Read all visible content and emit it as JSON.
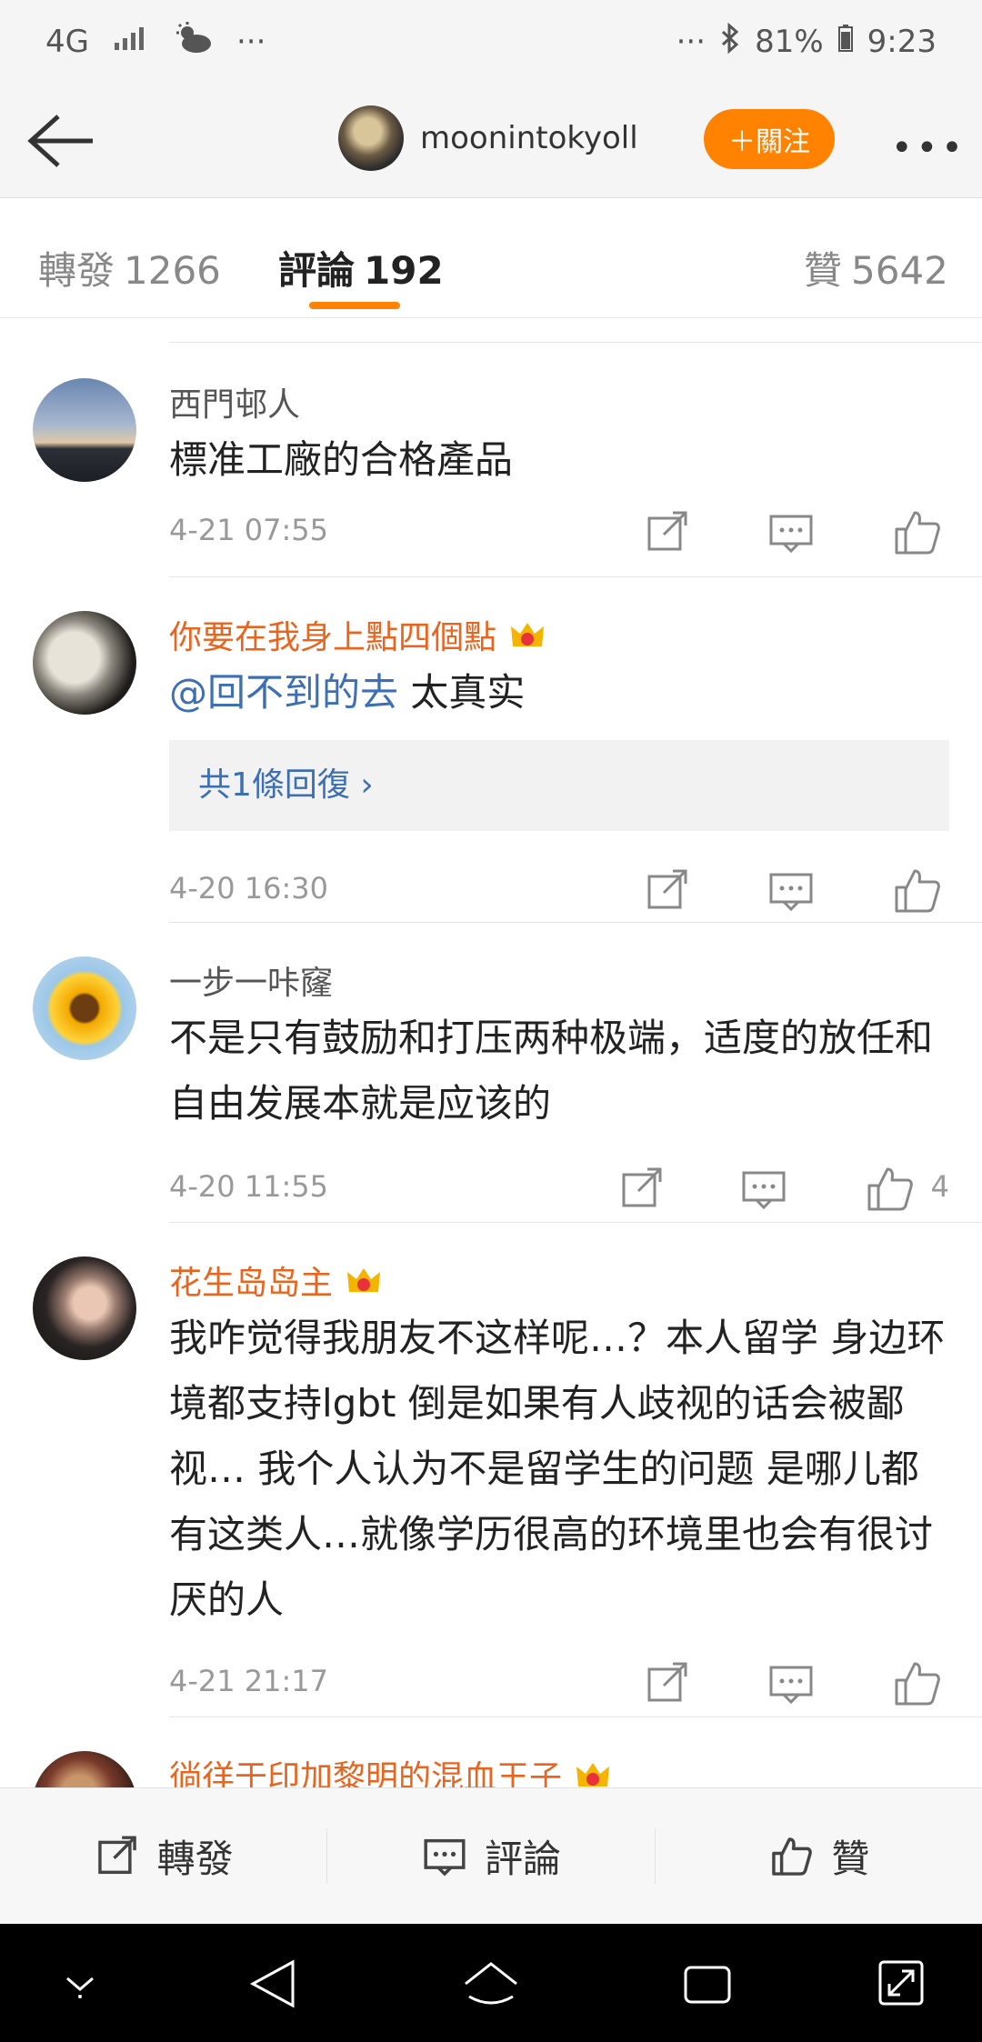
{
  "status_bar": {
    "network": "4G",
    "signal": "signal-icon",
    "weather": "cloudy-icon",
    "dots_left": "···",
    "dots_right": "···",
    "bluetooth": "bluetooth-icon",
    "battery": "81%",
    "time": "9:23"
  },
  "header": {
    "username": "moonintokyoll",
    "follow_label": "＋關注",
    "more_label": "•••"
  },
  "tabs": [
    {
      "label": "轉發",
      "count": "1266"
    },
    {
      "label": "評論",
      "count": "192"
    },
    {
      "label": "贊",
      "count": "5642"
    }
  ],
  "comments": [
    {
      "name": "西門邨人",
      "text": "標准工廠的合格產品",
      "time": "4-21 07:55",
      "likes": ""
    },
    {
      "name": "你要在我身上點四個點",
      "mention": "@回不到的去",
      "text": " 太真实",
      "reply_label": "共1條回復 ›",
      "time": "4-20 16:30",
      "likes": ""
    },
    {
      "name": "一步一咔窿",
      "text": "不是只有鼓励和打压两种极端，适度的放任和自由发展本就是应该的",
      "time": "4-20 11:55",
      "likes": "4"
    },
    {
      "name": "花生岛岛主",
      "text": "我咋觉得我朋友不这样呢…？本人留学 身边环境都支持lgbt 倒是如果有人歧视的话会被鄙视… 我个人认为不是留学生的问题 是哪儿都有这类人…就像学历很高的环境里也会有很讨厌的人",
      "time": "4-21 21:17",
      "likes": ""
    },
    {
      "name": "徜徉于印加黎明的混血王子"
    }
  ],
  "action_bar": {
    "repost": "轉發",
    "comment": "評論",
    "like": "贊"
  },
  "colors": {
    "accent": "#ff8200",
    "vip_name": "#e8651f",
    "link": "#3d6fb4"
  }
}
